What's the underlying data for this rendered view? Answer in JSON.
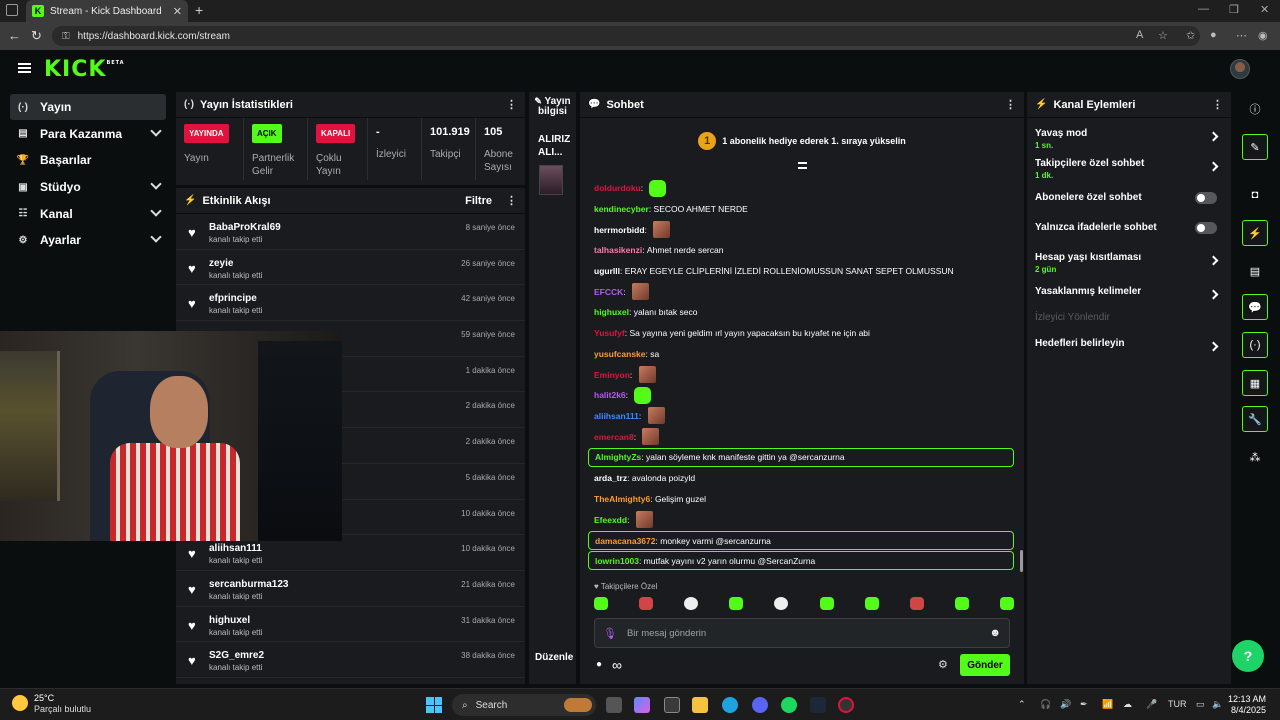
{
  "browser": {
    "tab_title": "Stream - Kick Dashboard",
    "tab_favicon": "K",
    "url": "https://dashboard.kick.com/stream"
  },
  "kick": {
    "logo": "KICK",
    "logo_badge": "BETA"
  },
  "sidebar": {
    "items": [
      {
        "label": "Yayın",
        "icon": "broadcast-icon",
        "glyph": "(·)"
      },
      {
        "label": "Para Kazanma",
        "icon": "money-icon",
        "glyph": "▤"
      },
      {
        "label": "Başarılar",
        "icon": "trophy-icon",
        "glyph": "🏆"
      },
      {
        "label": "Stüdyo",
        "icon": "studio-icon",
        "glyph": "▣"
      },
      {
        "label": "Kanal",
        "icon": "channel-icon",
        "glyph": "☷"
      },
      {
        "label": "Ayarlar",
        "icon": "gear-icon",
        "glyph": "⚙"
      }
    ]
  },
  "stats_panel": {
    "title": "Yayın İstatistikleri",
    "items": [
      {
        "badge": "YAYINDA",
        "label": "Yayın"
      },
      {
        "badge": "AÇIK",
        "label": "Partnerlik Gelir"
      },
      {
        "badge": "KAPALI",
        "label": "Çoklu Yayın"
      },
      {
        "value": "-",
        "label": "İzleyici"
      },
      {
        "value": "101.919",
        "label": "Takipçi"
      },
      {
        "value": "105",
        "label": "Abone Sayısı"
      }
    ]
  },
  "feed": {
    "title": "Etkinlik Akışı",
    "filter": "Filtre",
    "items": [
      {
        "name": "BabaProKral69",
        "sub": "kanalı takip etti",
        "time": "8 saniye önce"
      },
      {
        "name": "zeyie",
        "sub": "kanalı takip etti",
        "time": "26 saniye önce"
      },
      {
        "name": "efprincipe",
        "sub": "kanalı takip etti",
        "time": "42 saniye önce"
      },
      {
        "name": "",
        "sub": "",
        "time": "59 saniye önce"
      },
      {
        "name": "",
        "sub": "",
        "time": "1 dakika önce"
      },
      {
        "name": "",
        "sub": "",
        "time": "2 dakika önce"
      },
      {
        "name": "",
        "sub": "",
        "time": "2 dakika önce"
      },
      {
        "name": "",
        "sub": "",
        "time": "5 dakika önce"
      },
      {
        "name": "",
        "sub": "",
        "time": "10 dakika önce"
      },
      {
        "name": "aliihsan111",
        "sub": "kanalı takip etti",
        "time": "10 dakika önce"
      },
      {
        "name": "sercanburma123",
        "sub": "kanalı takip etti",
        "time": "21 dakika önce"
      },
      {
        "name": "highuxel",
        "sub": "kanalı takip etti",
        "time": "31 dakika önce"
      },
      {
        "name": "S2G_emre2",
        "sub": "kanalı takip etti",
        "time": "38 dakika önce"
      }
    ]
  },
  "stream_info": {
    "title": "Yayın bilgisi",
    "name": "ALIRIZ ALI...",
    "edit": "Düzenle"
  },
  "chat": {
    "title": "Sohbet",
    "promo": "1 abonelik hediye ederek 1. sıraya yükselin",
    "promo_rank": "1",
    "followers_only": "Takipçilere Özel",
    "placeholder": "Bir mesaj gönderin",
    "send": "Gönder",
    "messages": [
      {
        "user": "doldurdoku",
        "color": "#e2123f",
        "text": "",
        "emote": "green"
      },
      {
        "user": "kendinecyber",
        "color": "#53fc18",
        "text": "SECOO AHMET NERDE"
      },
      {
        "user": "herrmorbidd",
        "color": "#ffffff",
        "text": "",
        "emote": "face"
      },
      {
        "user": "talhasikenzi",
        "color": "#ff7aa8",
        "text": "Ahmet nerde sercan"
      },
      {
        "user": "ugurlll",
        "color": "#ffffff",
        "text": "ERAY EGEYLE CLİPLERİNİ İZLEDİ ROLLENİOMUSSUN SANAT SEPET OLMUSSUN"
      },
      {
        "user": "EFCCK",
        "color": "#b05cf2",
        "text": "",
        "emote": "face"
      },
      {
        "user": "highuxel",
        "color": "#53fc18",
        "text": "yalanı bıtak seco"
      },
      {
        "user": "Yusufyf",
        "color": "#e2123f",
        "text": "Sa yayına yeni geldim ırl yayın yapacaksın bu kıyafet ne için abi"
      },
      {
        "user": "yusufcanske",
        "color": "#ff9d2e",
        "text": "sa"
      },
      {
        "user": "Eminyon",
        "color": "#e2123f",
        "text": "",
        "emote": "face"
      },
      {
        "user": "halit2k6",
        "color": "#b05cf2",
        "text": "",
        "emote": "green"
      },
      {
        "user": "aliihsan111",
        "color": "#3d8bff",
        "text": "",
        "emote": "face"
      },
      {
        "user": "emercan8",
        "color": "#e2123f",
        "text": "",
        "emote": "face"
      },
      {
        "user": "AlmightyZs",
        "color": "#53fc18",
        "text": "yalan söyleme knk manifeste gittin ya @sercanzurna",
        "highlight": true
      },
      {
        "user": "arda_trz",
        "color": "#ffffff",
        "text": "avalonda poizyld"
      },
      {
        "user": "TheAlmighty6",
        "color": "#ff9d2e",
        "text": "Gelişim guzel"
      },
      {
        "user": "Efeexdd",
        "color": "#53fc18",
        "text": "",
        "emote": "face"
      },
      {
        "user": "damacana3672",
        "color": "#ff9d2e",
        "text": "monkey varmi @sercanzurna",
        "highlight": true
      },
      {
        "user": "lowrin1003",
        "color": "#53fc18",
        "text": "mutfak yayını v2 yarın olurmu @SercanZurna",
        "highlight": true
      }
    ]
  },
  "channel_actions": {
    "title": "Kanal Eylemleri",
    "items": [
      {
        "label": "Yavaş mod",
        "sub": "1 sn.",
        "type": "arrow"
      },
      {
        "label": "Takipçilere özel sohbet",
        "sub": "1 dk.",
        "type": "arrow"
      },
      {
        "label": "Abonelere özel sohbet",
        "type": "toggle"
      },
      {
        "label": "Yalnızca ifadelerle sohbet",
        "type": "toggle"
      },
      {
        "label": "Hesap yaşı kısıtlaması",
        "sub": "2 gün",
        "type": "arrow"
      },
      {
        "label": "Yasaklanmış kelimeler",
        "type": "arrow"
      },
      {
        "label": "İzleyici Yönlendir",
        "type": "disabled"
      },
      {
        "label": "Hedefleri belirleyin",
        "type": "arrow"
      }
    ]
  },
  "taskbar": {
    "temp": "25°C",
    "condition": "Parçalı bulutlu",
    "search": "Search",
    "lang": "TUR",
    "time": "12:13 AM",
    "date": "8/4/2025"
  },
  "colors": {
    "accent": "#53fc18",
    "live": "#e2123f",
    "panel": "#191b1f",
    "background": "#0b0e0f"
  }
}
